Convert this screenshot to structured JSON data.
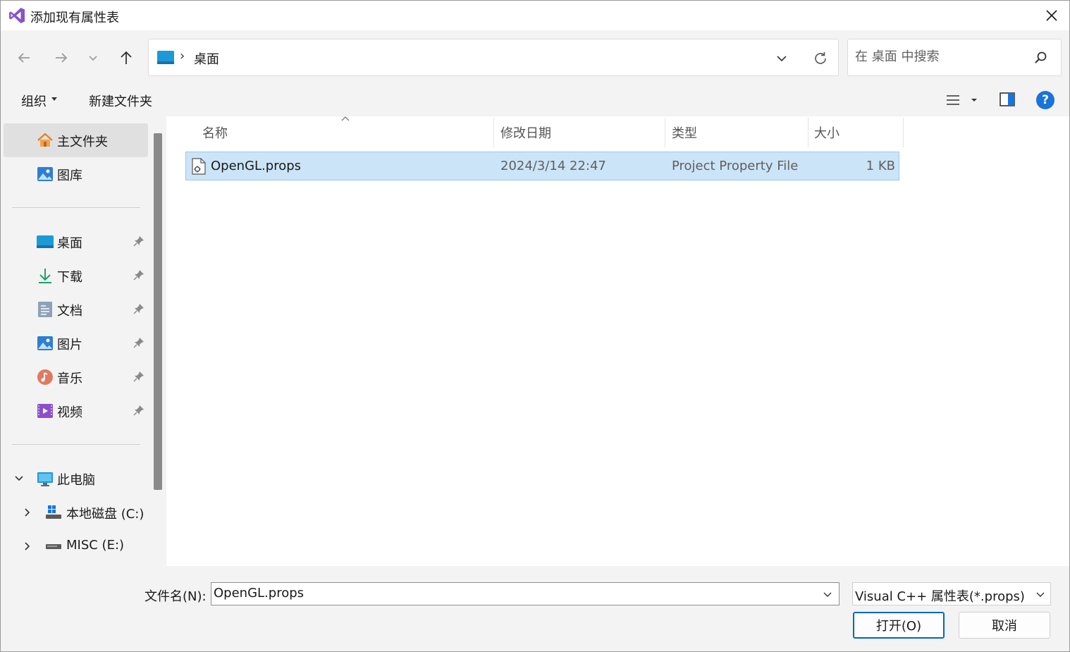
{
  "window": {
    "title": "添加现有属性表",
    "app_icon": "visual-studio-logo",
    "close_icon": "close-icon"
  },
  "navigation": {
    "back_icon": "arrow-left-icon",
    "forward_icon": "arrow-right-icon",
    "recent_icon": "chevron-down-icon",
    "up_icon": "arrow-up-icon",
    "breadcrumb_separator": "›",
    "breadcrumb": [
      "桌面"
    ],
    "search_placeholder": "在 桌面 中搜索"
  },
  "toolbar": {
    "organize_label": "组织",
    "new_folder_label": "新建文件夹",
    "help_label": "?"
  },
  "sidebar": {
    "quick_access": [
      {
        "label": "主文件夹",
        "icon": "home-icon",
        "selected": true
      },
      {
        "label": "图库",
        "icon": "gallery-icon"
      }
    ],
    "pinned": [
      {
        "label": "桌面",
        "icon": "desktop-icon"
      },
      {
        "label": "下载",
        "icon": "download-icon"
      },
      {
        "label": "文档",
        "icon": "document-icon"
      },
      {
        "label": "图片",
        "icon": "pictures-icon"
      },
      {
        "label": "音乐",
        "icon": "music-icon"
      },
      {
        "label": "视频",
        "icon": "video-icon"
      }
    ],
    "this_pc": {
      "label": "此电脑",
      "icon": "computer-icon"
    },
    "drives": [
      {
        "label": "本地磁盘 (C:)",
        "icon": "windows-drive-icon"
      },
      {
        "label": "MISC (E:)",
        "icon": "drive-icon"
      }
    ]
  },
  "file_list": {
    "columns": [
      "名称",
      "修改日期",
      "类型",
      "大小"
    ],
    "rows": [
      {
        "name": "OpenGL.props",
        "modified": "2024/3/14 22:47",
        "type": "Project Property File",
        "size": "1 KB",
        "selected": true
      }
    ]
  },
  "footer": {
    "filename_label": "文件名(N):",
    "filename_value": "OpenGL.props",
    "filetype_value": "Visual C++ 属性表(*.props)",
    "open_label": "打开(O)",
    "cancel_label": "取消"
  },
  "colors": {
    "accent": "#0067c0",
    "selection": "#cce4f7",
    "chrome": "#f3f3f3"
  }
}
